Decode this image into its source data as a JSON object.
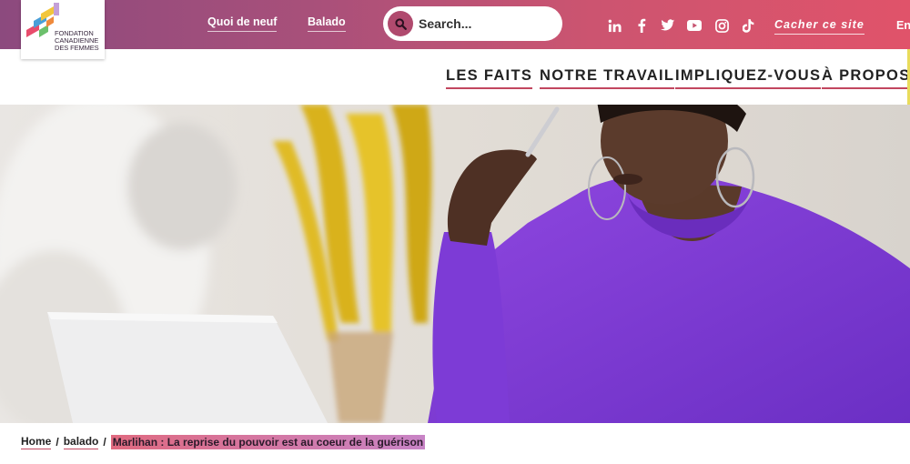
{
  "logo": {
    "lines": [
      "FONDATION",
      "CANADIENNE",
      "DES FEMMES"
    ]
  },
  "topbar": {
    "links": [
      "Quoi de neuf",
      "Balado"
    ],
    "search_placeholder": "Search...",
    "social_icons": [
      "linkedin-icon",
      "facebook-icon",
      "twitter-icon",
      "youtube-icon",
      "instagram-icon",
      "tiktok-icon"
    ],
    "hide_site": "Cacher ce site",
    "language": "Eng"
  },
  "nav": {
    "items": [
      "LES FAITS",
      "NOTRE TRAVAIL",
      "IMPLIQUEZ-VOUS",
      "À PROPOS"
    ]
  },
  "breadcrumb": {
    "home": "Home",
    "section": "balado",
    "current": "Marlihan : La reprise du pouvoir est au coeur de la guérison"
  },
  "colors": {
    "brand_pink": "#c2465f",
    "topbar_start": "#8c4a7e",
    "topbar_end": "#e0536a",
    "accent_yellow": "#e9dc5b"
  }
}
